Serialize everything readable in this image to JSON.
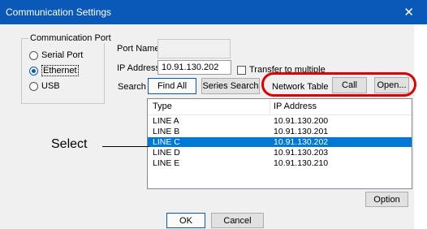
{
  "window": {
    "title": "Communication Settings",
    "close_glyph": "✕"
  },
  "comm_port": {
    "label": "Communication Port",
    "options": [
      {
        "label": "Serial Port",
        "checked": false
      },
      {
        "label": "Ethernet",
        "checked": true
      },
      {
        "label": "USB",
        "checked": false
      }
    ]
  },
  "port_name": {
    "label": "Port Name",
    "value": ""
  },
  "ip_address": {
    "label": "IP Address",
    "value": "10.91.130.202"
  },
  "transfer_multiple": {
    "label": "Transfer to multiple",
    "checked": false
  },
  "search": {
    "label": "Search",
    "find_all": "Find All",
    "series_search": "Series Search",
    "network_table_label": "Network Table",
    "call": "Call",
    "open": "Open..."
  },
  "table": {
    "columns": [
      "Type",
      "IP Address"
    ],
    "rows": [
      {
        "type": "LINE A",
        "ip": "10.91.130.200",
        "selected": false
      },
      {
        "type": "LINE B",
        "ip": "10.91.130.201",
        "selected": false
      },
      {
        "type": "LINE C",
        "ip": "10.91.130.202",
        "selected": true
      },
      {
        "type": "LINE D",
        "ip": "10.91.130.203",
        "selected": false
      },
      {
        "type": "LINE E",
        "ip": "10.91.130.210",
        "selected": false
      }
    ]
  },
  "buttons": {
    "option": "Option",
    "ok": "OK",
    "cancel": "Cancel"
  },
  "annotation": {
    "callout": "Select",
    "highlight_color": "#e00000"
  },
  "colors": {
    "titlebar": "#0a59b8",
    "selection": "#0078d7"
  }
}
